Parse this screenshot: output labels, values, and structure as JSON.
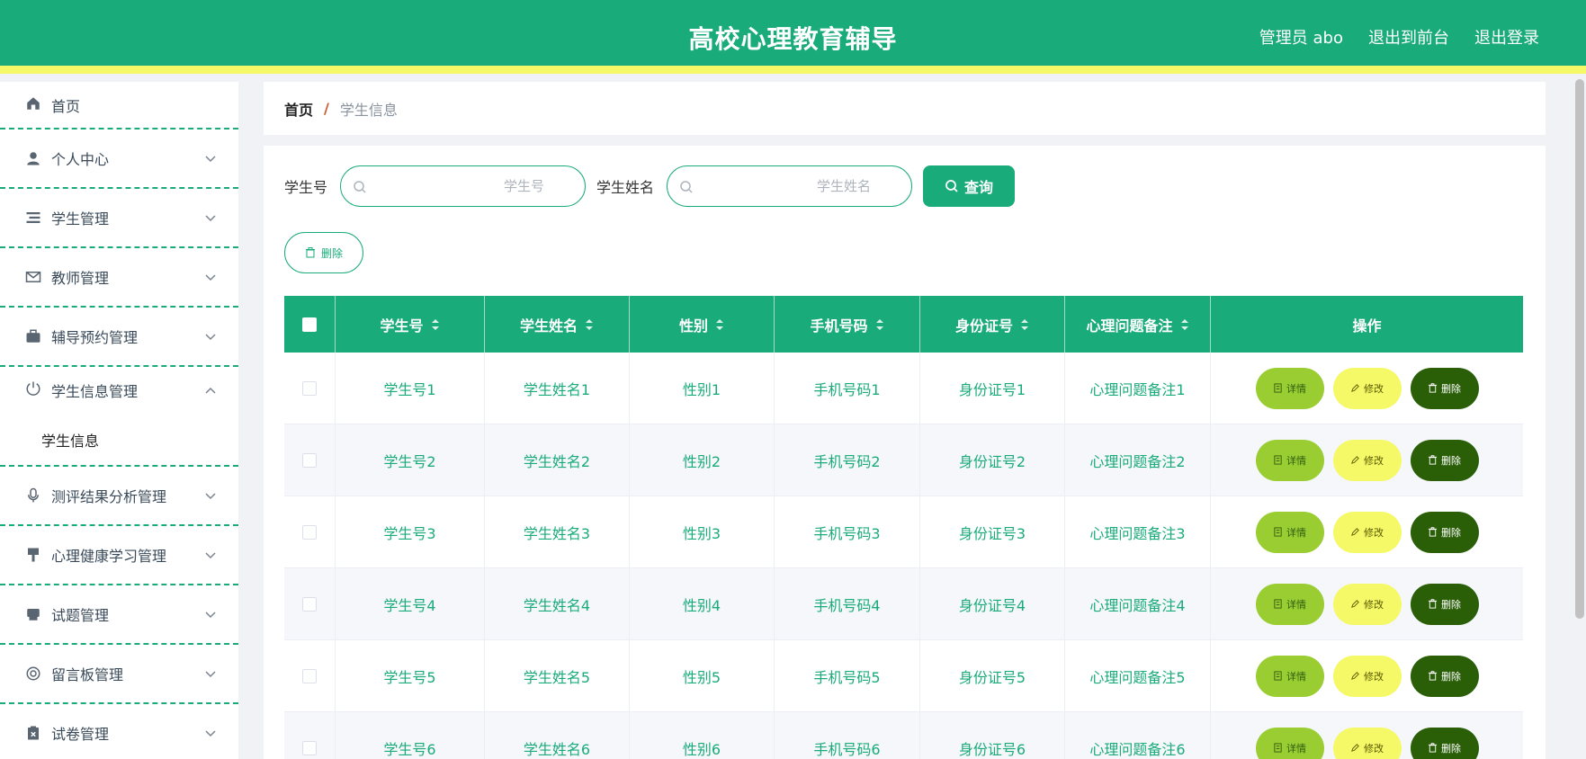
{
  "header": {
    "title": "高校心理教育辅导",
    "user_label": "管理员 abo",
    "front_label": "退出到前台",
    "logout_label": "退出登录"
  },
  "sidebar": {
    "items": [
      {
        "label": "首页",
        "icon": "home-icon"
      },
      {
        "label": "个人中心",
        "icon": "user-icon"
      },
      {
        "label": "学生管理",
        "icon": "list-icon"
      },
      {
        "label": "教师管理",
        "icon": "mail-icon"
      },
      {
        "label": "辅导预约管理",
        "icon": "briefcase-icon"
      },
      {
        "label": "学生信息管理",
        "icon": "power-icon"
      },
      {
        "label": "测评结果分析管理",
        "icon": "microphone-icon"
      },
      {
        "label": "心理健康学习管理",
        "icon": "brush-icon"
      },
      {
        "label": "试题管理",
        "icon": "printer-icon"
      },
      {
        "label": "留言板管理",
        "icon": "lifebuoy-icon"
      },
      {
        "label": "试卷管理",
        "icon": "clipboard-icon"
      }
    ],
    "sub_item": "学生信息"
  },
  "breadcrumb": {
    "home": "首页",
    "separator": "/",
    "current": "学生信息"
  },
  "search": {
    "student_no_label": "学生号",
    "student_no_placeholder": "学生号",
    "student_name_label": "学生姓名",
    "student_name_placeholder": "学生姓名",
    "query_label": "查询",
    "bulk_delete_label": "删除"
  },
  "table": {
    "columns": [
      "学生号",
      "学生姓名",
      "性别",
      "手机号码",
      "身份证号",
      "心理问题备注",
      "操作"
    ],
    "rows": [
      [
        "学生号1",
        "学生姓名1",
        "性别1",
        "手机号码1",
        "身份证号1",
        "心理问题备注1"
      ],
      [
        "学生号2",
        "学生姓名2",
        "性别2",
        "手机号码2",
        "身份证号2",
        "心理问题备注2"
      ],
      [
        "学生号3",
        "学生姓名3",
        "性别3",
        "手机号码3",
        "身份证号3",
        "心理问题备注3"
      ],
      [
        "学生号4",
        "学生姓名4",
        "性别4",
        "手机号码4",
        "身份证号4",
        "心理问题备注4"
      ],
      [
        "学生号5",
        "学生姓名5",
        "性别5",
        "手机号码5",
        "身份证号5",
        "心理问题备注5"
      ],
      [
        "学生号6",
        "学生姓名6",
        "性别6",
        "手机号码6",
        "身份证号6",
        "心理问题备注6"
      ]
    ],
    "actions": {
      "detail": "详情",
      "edit": "修改",
      "delete": "删除"
    }
  },
  "colors": {
    "primary": "#1aab7a",
    "accent_yellow": "#f5f867",
    "detail_btn": "#9acd32",
    "delete_btn": "#2a5f08"
  }
}
